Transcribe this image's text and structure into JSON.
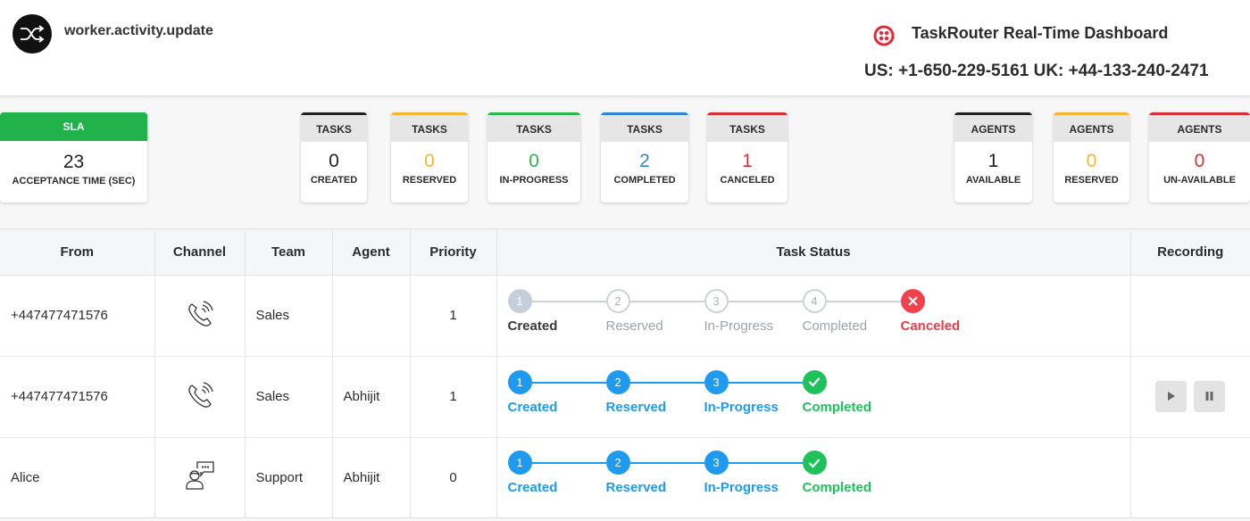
{
  "header": {
    "event_icon": "shuffle-icon",
    "event_name": "worker.activity.update",
    "brand_icon": "twilio-logo-icon",
    "brand_title": "TaskRouter Real-Time Dashboard",
    "phones": "US: +1-650-229-5161 UK: +44-133-240-2471"
  },
  "sla": {
    "title": "SLA",
    "value": "23",
    "label": "ACCEPTANCE TIME (SEC)",
    "color": "#22b24c"
  },
  "task_cards": [
    {
      "title": "TASKS",
      "value": "0",
      "label": "CREATED",
      "color": "#222222"
    },
    {
      "title": "TASKS",
      "value": "0",
      "label": "RESERVED",
      "color": "#f5b82e"
    },
    {
      "title": "TASKS",
      "value": "0",
      "label": "IN-PROGRESS",
      "color": "#2db84d"
    },
    {
      "title": "TASKS",
      "value": "2",
      "label": "COMPLETED",
      "color": "#2f86d6"
    },
    {
      "title": "TASKS",
      "value": "1",
      "label": "CANCELED",
      "color": "#d8303a"
    }
  ],
  "agent_cards": [
    {
      "title": "AGENTS",
      "value": "1",
      "label": "AVAILABLE",
      "color": "#222222"
    },
    {
      "title": "AGENTS",
      "value": "0",
      "label": "RESERVED",
      "color": "#f5b82e"
    },
    {
      "title": "AGENTS",
      "value": "0",
      "label": "UN-AVAILABLE",
      "color": "#d8303a"
    }
  ],
  "table": {
    "columns": [
      "From",
      "Channel",
      "Team",
      "Agent",
      "Priority",
      "Task Status",
      "Recording"
    ],
    "rows": [
      {
        "from": "+447477471576",
        "channel": "voice-call-icon",
        "team": "Sales",
        "agent": "",
        "priority": "1",
        "status": "canceled",
        "steps": [
          {
            "num": "1",
            "label": "Created"
          },
          {
            "num": "2",
            "label": "Reserved"
          },
          {
            "num": "3",
            "label": "In-Progress"
          },
          {
            "num": "4",
            "label": "Completed"
          },
          {
            "num": "",
            "label": "Canceled"
          }
        ],
        "recording": false
      },
      {
        "from": "+447477471576",
        "channel": "voice-call-icon",
        "team": "Sales",
        "agent": "Abhijit",
        "priority": "1",
        "status": "completed",
        "steps": [
          {
            "num": "1",
            "label": "Created"
          },
          {
            "num": "2",
            "label": "Reserved"
          },
          {
            "num": "3",
            "label": "In-Progress"
          },
          {
            "num": "",
            "label": "Completed"
          }
        ],
        "recording": true,
        "recording_controls": [
          "play-icon",
          "pause-icon"
        ]
      },
      {
        "from": "Alice",
        "channel": "chat-agent-icon",
        "team": "Support",
        "agent": "Abhijit",
        "priority": "0",
        "status": "completed",
        "steps": [
          {
            "num": "1",
            "label": "Created"
          },
          {
            "num": "2",
            "label": "Reserved"
          },
          {
            "num": "3",
            "label": "In-Progress"
          },
          {
            "num": "",
            "label": "Completed"
          }
        ],
        "recording": false
      }
    ]
  }
}
